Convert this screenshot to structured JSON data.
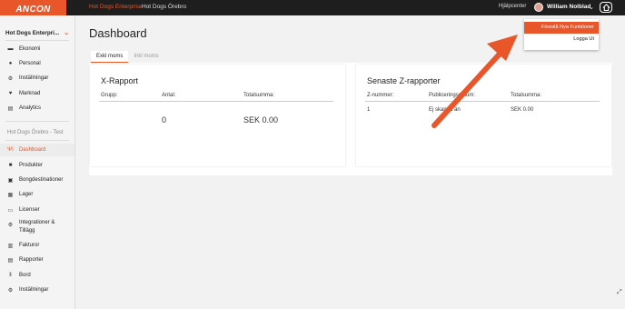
{
  "logo": "ANCON",
  "breadcrumbs": [
    "Hot Dogs Enterprise",
    "Hot Dogs Örebro"
  ],
  "header": {
    "help": "Hjälpcenter",
    "user": "William Nolblad"
  },
  "user_menu": {
    "items": [
      "Föreslå Nya Funktioner",
      "Logga Ut"
    ]
  },
  "sidebar": {
    "org": "Hot Dogs Enterpri...",
    "enterprise_items": [
      {
        "label": "Ekonomi",
        "icon": "wallet-icon"
      },
      {
        "label": "Personal",
        "icon": "people-icon"
      },
      {
        "label": "Inställningar",
        "icon": "gear-icon"
      },
      {
        "label": "Marknad",
        "icon": "heart-icon"
      },
      {
        "label": "Analytics",
        "icon": "document-icon"
      }
    ],
    "location_label": "Hot Dogs Örebro - Test",
    "location_items": [
      {
        "label": "Dashboard",
        "icon": "fork-knife-icon",
        "active": true
      },
      {
        "label": "Produkter",
        "icon": "box-icon"
      },
      {
        "label": "Bongdestinationer",
        "icon": "receipt-icon"
      },
      {
        "label": "Lager",
        "icon": "archive-icon"
      },
      {
        "label": "Licenser",
        "icon": "monitor-icon"
      },
      {
        "label": "Integrationer &",
        "label2": "Tillägg",
        "icon": "gears-icon"
      },
      {
        "label": "Fakturor",
        "icon": "invoice-icon"
      },
      {
        "label": "Rapporter",
        "icon": "report-icon"
      },
      {
        "label": "Bord",
        "icon": "table-icon"
      },
      {
        "label": "Inställningar",
        "icon": "gear-icon"
      }
    ]
  },
  "main": {
    "title": "Dashboard",
    "tabs": [
      "Exkl moms",
      "Inkl moms"
    ],
    "x_report": {
      "title": "X-Rapport",
      "columns": [
        "Grupp:",
        "Antal:",
        "Totalsumma:"
      ],
      "antal": "0",
      "total": "SEK 0.00"
    },
    "z_reports": {
      "title": "Senaste Z-rapporter",
      "columns": [
        "Z-nummer:",
        "Publiceringsdatum:",
        "Totalsumma:"
      ],
      "rows": [
        {
          "number": "1",
          "date": "Ej skapad än",
          "total": "SEK 0.00"
        }
      ]
    }
  },
  "colors": {
    "accent": "#e8562a",
    "topbar": "#1e1e1e"
  }
}
